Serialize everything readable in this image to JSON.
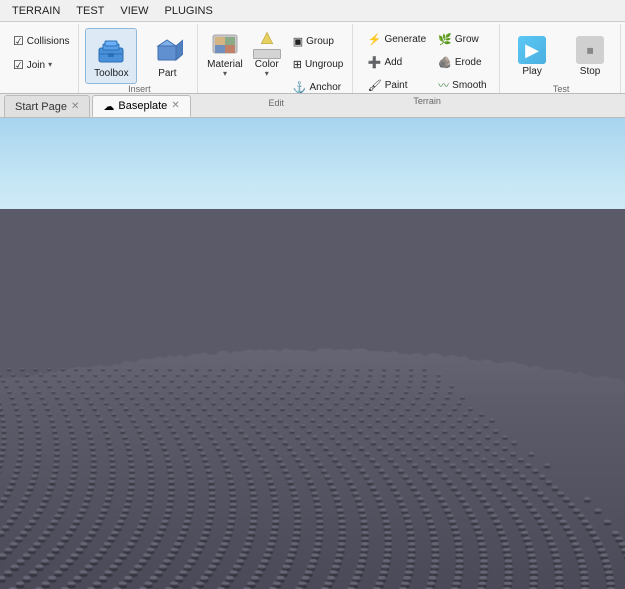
{
  "menubar": {
    "items": [
      "TERRAIN",
      "TEST",
      "VIEW",
      "PLUGINS"
    ]
  },
  "ribbon": {
    "groups": [
      {
        "name": "home-group",
        "label": "",
        "items": [
          {
            "id": "collisions",
            "label": "Collisions",
            "type": "small-check"
          },
          {
            "id": "join",
            "label": "Join",
            "type": "small-check"
          }
        ]
      },
      {
        "name": "insert-group",
        "label": "Insert",
        "items": [
          {
            "id": "toolbox",
            "label": "Toolbox",
            "type": "large",
            "active": true
          },
          {
            "id": "part",
            "label": "Part",
            "type": "large"
          }
        ]
      },
      {
        "name": "edit-group",
        "label": "Edit",
        "items": [
          {
            "id": "material",
            "label": "Material",
            "type": "large-split"
          },
          {
            "id": "color",
            "label": "Color",
            "type": "large-split"
          },
          {
            "id": "group",
            "label": "Group",
            "type": "small"
          },
          {
            "id": "ungroup",
            "label": "Ungroup",
            "type": "small"
          },
          {
            "id": "anchor",
            "label": "Anchor",
            "type": "small"
          }
        ]
      },
      {
        "name": "terrain-group",
        "label": "Terrain",
        "items": [
          {
            "id": "generate",
            "label": "Generate",
            "type": "small"
          },
          {
            "id": "add",
            "label": "Add",
            "type": "small"
          },
          {
            "id": "paint",
            "label": "Paint",
            "type": "small"
          },
          {
            "id": "grow",
            "label": "Grow",
            "type": "small"
          },
          {
            "id": "erode",
            "label": "Erode",
            "type": "small"
          },
          {
            "id": "smooth",
            "label": "Smooth",
            "type": "small"
          }
        ]
      },
      {
        "name": "test-group",
        "label": "Test",
        "items": [
          {
            "id": "play",
            "label": "Play",
            "type": "large-blue"
          },
          {
            "id": "stop",
            "label": "Stop",
            "type": "large-gray"
          }
        ]
      }
    ]
  },
  "tabs": [
    {
      "id": "start-page",
      "label": "Start Page",
      "closeable": true,
      "active": false,
      "icon": ""
    },
    {
      "id": "baseplate",
      "label": "Baseplate",
      "closeable": true,
      "active": true,
      "icon": "cloud"
    }
  ],
  "viewport": {
    "sky_color": "#a8d4ef",
    "terrain_color": "#5a5a6a"
  },
  "icons": {
    "toolbox": "🧰",
    "part": "🟦",
    "material": "🪨",
    "color": "🎨",
    "play": "▶",
    "stop": "⏹",
    "cloud": "☁",
    "mountain": "⛰",
    "tree": "🌲",
    "erode": "💧",
    "smooth_icon": "〰",
    "anchor": "⚓",
    "checkbox": "☑",
    "group_icon": "▣",
    "generate": "⚡",
    "grow": "↑",
    "add": "➕",
    "paint": "🖌"
  }
}
